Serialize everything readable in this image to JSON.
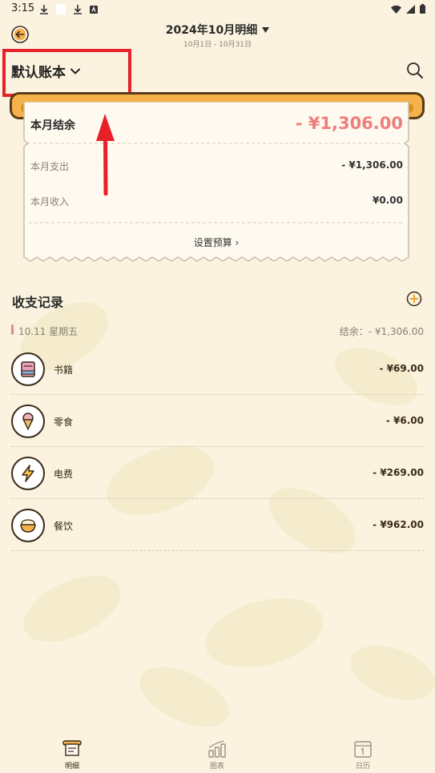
{
  "status_bar": {
    "time": "3:15"
  },
  "header": {
    "title": "2024年10月明细",
    "subtitle": "10月1日 - 10月31日"
  },
  "account": {
    "name": "默认账本"
  },
  "summary": {
    "balance_label": "本月结余",
    "balance_value": "- ¥1,306.00",
    "expense_label": "本月支出",
    "expense_value": "- ¥1,306.00",
    "income_label": "本月收入",
    "income_value": "¥0.00",
    "budget_link": "设置预算 ›"
  },
  "records": {
    "title": "收支记录",
    "day_label": "10.11 星期五",
    "day_balance": "结余：- ¥1,306.00",
    "items": [
      {
        "name": "书籍",
        "amount": "- ¥69.00",
        "icon": "book-icon"
      },
      {
        "name": "零食",
        "amount": "- ¥6.00",
        "icon": "ice-cream-icon"
      },
      {
        "name": "电费",
        "amount": "- ¥269.00",
        "icon": "lightning-icon"
      },
      {
        "name": "餐饮",
        "amount": "- ¥962.00",
        "icon": "food-bowl-icon"
      }
    ]
  },
  "bottom_nav": {
    "items": [
      {
        "label": "明细",
        "icon": "receipt-icon",
        "active": true
      },
      {
        "label": "图表",
        "icon": "chart-icon",
        "active": false
      },
      {
        "label": "日历",
        "icon": "calendar-icon",
        "active": false
      }
    ]
  },
  "colors": {
    "background": "#fbf3df",
    "accent_orange": "#f5b24a",
    "balance_red": "#f07d7d",
    "highlight_red": "#e8202a"
  }
}
